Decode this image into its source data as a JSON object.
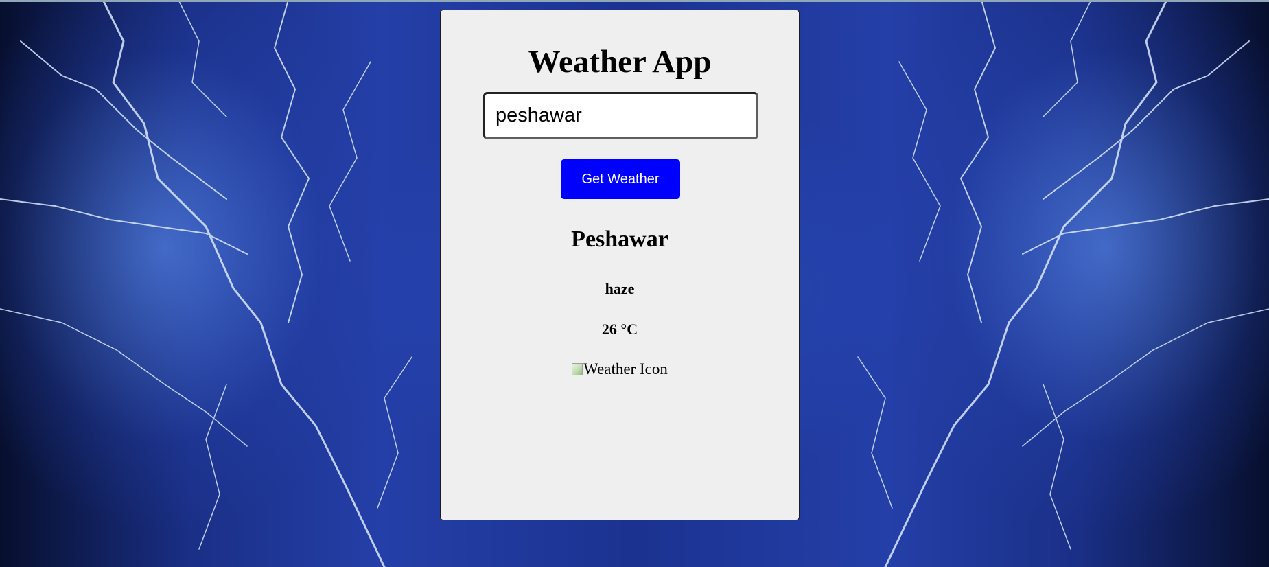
{
  "app": {
    "title": "Weather App"
  },
  "search": {
    "value": "peshawar",
    "button_label": "Get Weather"
  },
  "result": {
    "city": "Peshawar",
    "description": "haze",
    "temperature": "26 °C",
    "icon_alt": "Weather Icon"
  },
  "colors": {
    "button_bg": "#0000ff",
    "card_bg": "#efefef",
    "background_theme": "blue lightning"
  }
}
